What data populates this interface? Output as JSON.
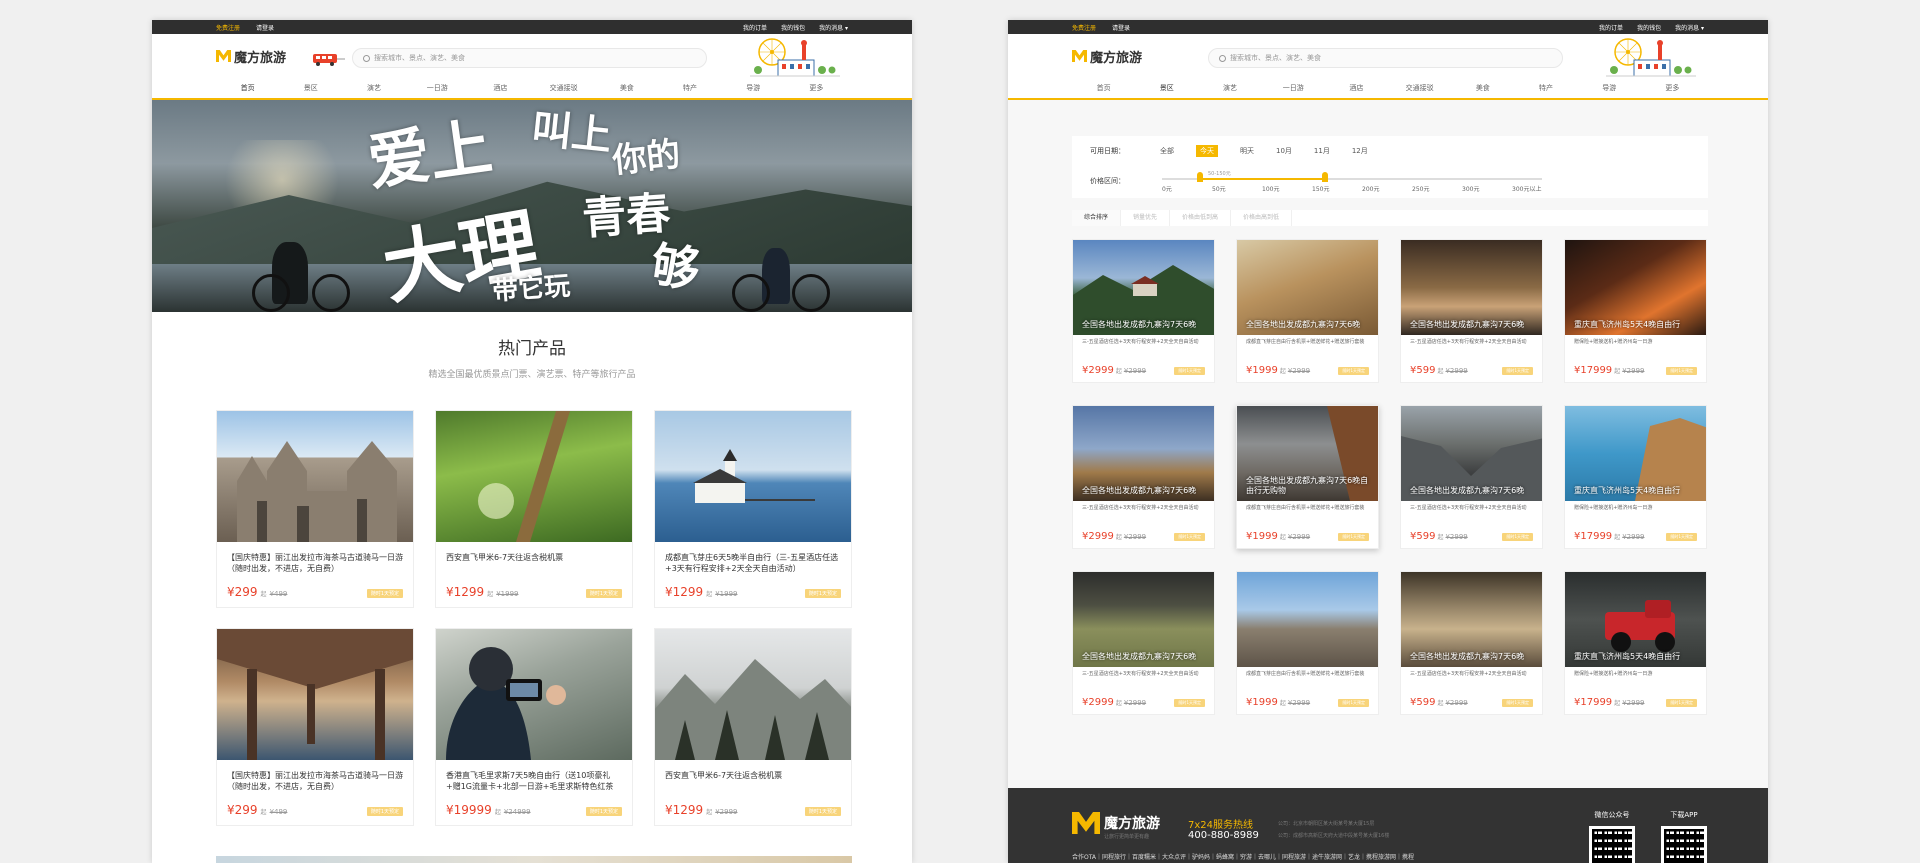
{
  "topbar": {
    "register": "免费注册",
    "login": "请登录",
    "orders": "我的订单",
    "wallet": "我的钱包",
    "messages": "我的消息 ▾"
  },
  "brand": {
    "name": "魔方旅游",
    "accent": "#f5b800",
    "price_color": "#e8412a"
  },
  "search": {
    "placeholder": "搜索城市、景点、演艺、美食"
  },
  "nav": [
    "首页",
    "景区",
    "演艺",
    "一日游",
    "酒店",
    "交通接驳",
    "美食",
    "特产",
    "导游",
    "更多"
  ],
  "home": {
    "banner_text": [
      "爱上",
      "叫上",
      "你的",
      "大理",
      "青春",
      "带它玩",
      "够"
    ],
    "section_title": "热门产品",
    "section_subtitle": "精选全国最优质景点门票、演艺票、特产等旅行产品",
    "products": [
      {
        "title": "【国庆特惠】丽江出发拉市海茶马古道骑马一日游（随时出发，不进店，无自费）",
        "price": "¥299",
        "qi": "起",
        "old": "¥499",
        "tag": "随时1天预定",
        "img": "cathedral"
      },
      {
        "title": "西安直飞甲米6-7天往返含税机票",
        "price": "¥1299",
        "qi": "起",
        "old": "¥1999",
        "tag": "随时1天预定",
        "img": "grass"
      },
      {
        "title": "成都直飞芽庄6天5晚半自由行（三-五星酒店任选+3天有行程安排+2天全天自由活动）",
        "price": "¥1299",
        "qi": "起",
        "old": "¥1999",
        "tag": "随时1天预定",
        "img": "lake-castle"
      },
      {
        "title": "【国庆特惠】丽江出发拉市海茶马古道骑马一日游（随时出发，不进店，无自费）",
        "price": "¥299",
        "qi": "起",
        "old": "¥499",
        "tag": "随时1天预定",
        "img": "pier"
      },
      {
        "title": "香港直飞毛里求斯7天5晚自由行（送10项豪礼+赠1G流量卡+北部一日游+毛里求斯特色红茶",
        "price": "¥19999",
        "qi": "起",
        "old": "¥24999",
        "tag": "随时1天预定",
        "img": "phone"
      },
      {
        "title": "西安直飞甲米6-7天往返含税机票",
        "price": "¥1299",
        "qi": "起",
        "old": "¥2999",
        "tag": "随时1天预定",
        "img": "snow-forest"
      }
    ]
  },
  "list": {
    "filter": {
      "date_label": "可用日期：",
      "date_options": [
        "全部",
        "今天",
        "明天",
        "10月",
        "11月",
        "12月"
      ],
      "date_selected": "今天",
      "price_label": "价格区间：",
      "price_ticks": [
        "0元",
        "50元",
        "100元",
        "150元",
        "200元",
        "250元",
        "300元",
        "300元以上"
      ],
      "price_range_text": "50-150元"
    },
    "sort": [
      "综合排序",
      "销量优先",
      "价格由低到高",
      "价格由高到低"
    ],
    "sort_selected": "综合排序",
    "items": [
      {
        "caption": "全国各地出发成都九寨沟7天6晚",
        "desc": "三-五星酒店任选+3天有行程安排+2天全天自由活动",
        "price": "¥2999",
        "old": "¥2999",
        "img": "lake-house"
      },
      {
        "caption": "全国各地出发成都九寨沟7天6晚",
        "desc": "成都直飞芽庄自由行含机票+赠送鲜花+赠送旅行套装",
        "price": "¥1999",
        "old": "¥2999",
        "img": "coconut"
      },
      {
        "caption": "全国各地出发成都九寨沟7天6晚",
        "desc": "三-五星酒店任选+3天有行程安排+2天全天自由活动",
        "price": "¥599",
        "old": "¥2999",
        "img": "street"
      },
      {
        "caption": "重庆直飞济州岛5天4晚自由行",
        "desc": "赠保险+赠接送机+赠济州岛一日游",
        "price": "¥17999",
        "old": "¥2999",
        "img": "fire"
      },
      {
        "caption": "全国各地出发成都九寨沟7天6晚",
        "desc": "三-五星酒店任选+3天有行程安排+2天全天自由活动",
        "price": "¥2999",
        "old": "¥2999",
        "img": "sky-field"
      },
      {
        "caption": "全国各地出发成都九寨沟7天6晚自由行无购物",
        "desc": "成都直飞芽庄自由行含机票+赠送鲜花+赠送旅行套装",
        "price": "¥1999",
        "old": "¥2999",
        "img": "cliff-fog"
      },
      {
        "caption": "全国各地出发成都九寨沟7天6晚",
        "desc": "三-五星酒店任选+3天有行程安排+2天全天自由活动",
        "price": "¥599",
        "old": "¥2999",
        "img": "canyon"
      },
      {
        "caption": "重庆直飞济州岛5天4晚自由行",
        "desc": "赠保险+赠接送机+赠济州岛一日游",
        "price": "¥17999",
        "old": "¥2999",
        "img": "sea-cliff"
      },
      {
        "caption": "全国各地出发成都九寨沟7天6晚",
        "desc": "三-五星酒店任选+3天有行程安排+2天全天自由活动",
        "price": "¥2999",
        "old": "¥2999",
        "img": "sheep"
      },
      {
        "caption": "",
        "desc": "成都直飞芽庄自由行含机票+赠送鲜花+赠送旅行套装",
        "price": "¥1999",
        "old": "¥2999",
        "img": "mountain-sea"
      },
      {
        "caption": "全国各地出发成都九寨沟7天6晚",
        "desc": "三-五星酒店任选+3天有行程安排+2天全天自由活动",
        "price": "¥599",
        "old": "¥2999",
        "img": "church"
      },
      {
        "caption": "重庆直飞济州岛5天4晚自由行",
        "desc": "赠保险+赠接送机+赠济州岛一日游",
        "price": "¥17999",
        "old": "¥2999",
        "img": "truck"
      }
    ],
    "qi": "起",
    "tag": "随时1天预定"
  },
  "footer": {
    "slogan": "让旅行更简单更有趣",
    "hotline": "7x24服务热线",
    "phone": "400-880-8989",
    "addr1": "公司：北京市朝阳区某大街某号某大厦15层",
    "addr2": "公司：成都市高新区天府大道中段某号某大厦16楼",
    "links": "合作OTA｜同程旅行｜百度糯米｜大众点评｜驴妈妈｜蚂蜂窝｜穷游｜去哪儿｜同程旅游｜途牛旅游网｜艺龙｜携程旅游网｜携程",
    "wechat": "微信公众号",
    "app": "下载APP"
  }
}
